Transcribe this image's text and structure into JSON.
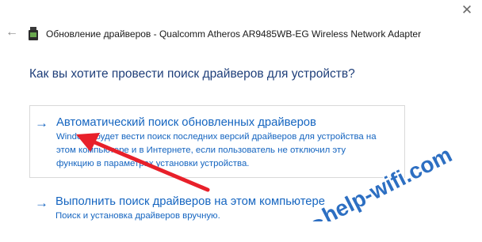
{
  "window": {
    "close_label": "✕",
    "back_label": "←",
    "title": "Обновление драйверов - Qualcomm Atheros AR9485WB-EG Wireless Network Adapter"
  },
  "heading": "Как вы хотите провести поиск драйверов для устройств?",
  "options": [
    {
      "arrow": "→",
      "title": "Автоматический поиск обновленных драйверов",
      "description_lines": [
        "Windows будет вести поиск последних версий драйверов для устройства на",
        "этом компьютере и в Интернете, если пользователь не отключил эту",
        "функцию в параметрах установки устройства."
      ]
    },
    {
      "arrow": "→",
      "title": "Выполнить поиск драйверов на этом компьютере",
      "description": "Поиск и установка драйверов вручную."
    }
  ],
  "watermark": "help-wifi.com",
  "colors": {
    "link_blue": "#1565c0",
    "heading_blue": "#1f3f7a",
    "annotation_red": "#e8202a",
    "watermark_blue": "#2d6fc2"
  },
  "icons": {
    "device": "network-adapter-icon",
    "back": "back-arrow-icon",
    "close": "close-icon"
  }
}
